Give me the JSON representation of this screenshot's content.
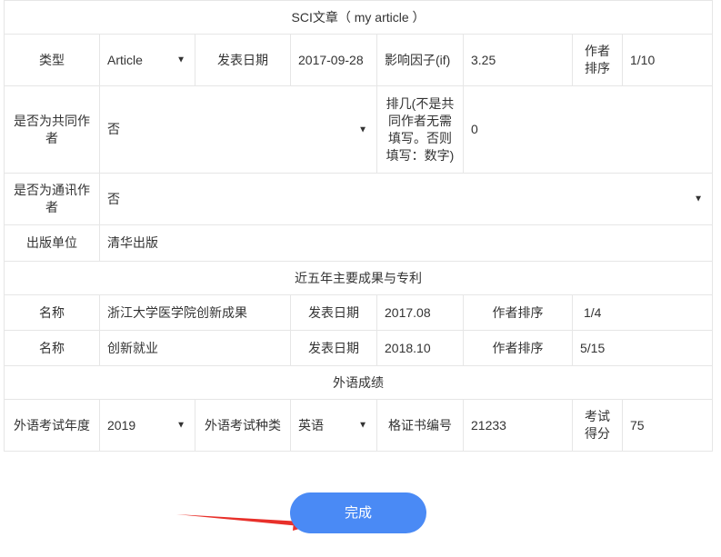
{
  "sci": {
    "title": "SCI文章（ my article ）",
    "type_label": "类型",
    "type_value": "Article",
    "pub_date_label": "发表日期",
    "pub_date_value": "2017-09-28",
    "impact_label": "影响因子(if)",
    "impact_value": "3.25",
    "author_rank_label": "作者排序",
    "author_rank_value": "1/10",
    "co_author_label": "是否为共同作者",
    "co_author_value": "否",
    "rank_note_label": "排几(不是共同作者无需填写。否则填写：数字)",
    "rank_note_value": "0",
    "corresponding_label": "是否为通讯作者",
    "corresponding_value": "否",
    "publisher_label": "出版单位",
    "publisher_value": "清华出版"
  },
  "achievements": {
    "title": "近五年主要成果与专利",
    "rows": [
      {
        "name_label": "名称",
        "name_value": "浙江大学医学院创新成果",
        "date_label": "发表日期",
        "date_value": "2017.08",
        "rank_label": "作者排序",
        "rank_value": "1/4"
      },
      {
        "name_label": "名称",
        "name_value": "创新就业",
        "date_label": "发表日期",
        "date_value": "2018.10",
        "rank_label": "作者排序",
        "rank_value": "5/15"
      }
    ]
  },
  "language": {
    "title": "外语成绩",
    "year_label": "外语考试年度",
    "year_value": "2019",
    "kind_label": "外语考试种类",
    "kind_value": "英语",
    "cert_label": "格证书编号",
    "cert_value": "21233",
    "score_label": "考试得分",
    "score_value": "75"
  },
  "icons": {
    "caret": "▼"
  },
  "actions": {
    "done_label": "完成"
  },
  "colors": {
    "accent": "#4a8af5",
    "arrow": "#e8302a",
    "border": "#e6e6e6"
  }
}
